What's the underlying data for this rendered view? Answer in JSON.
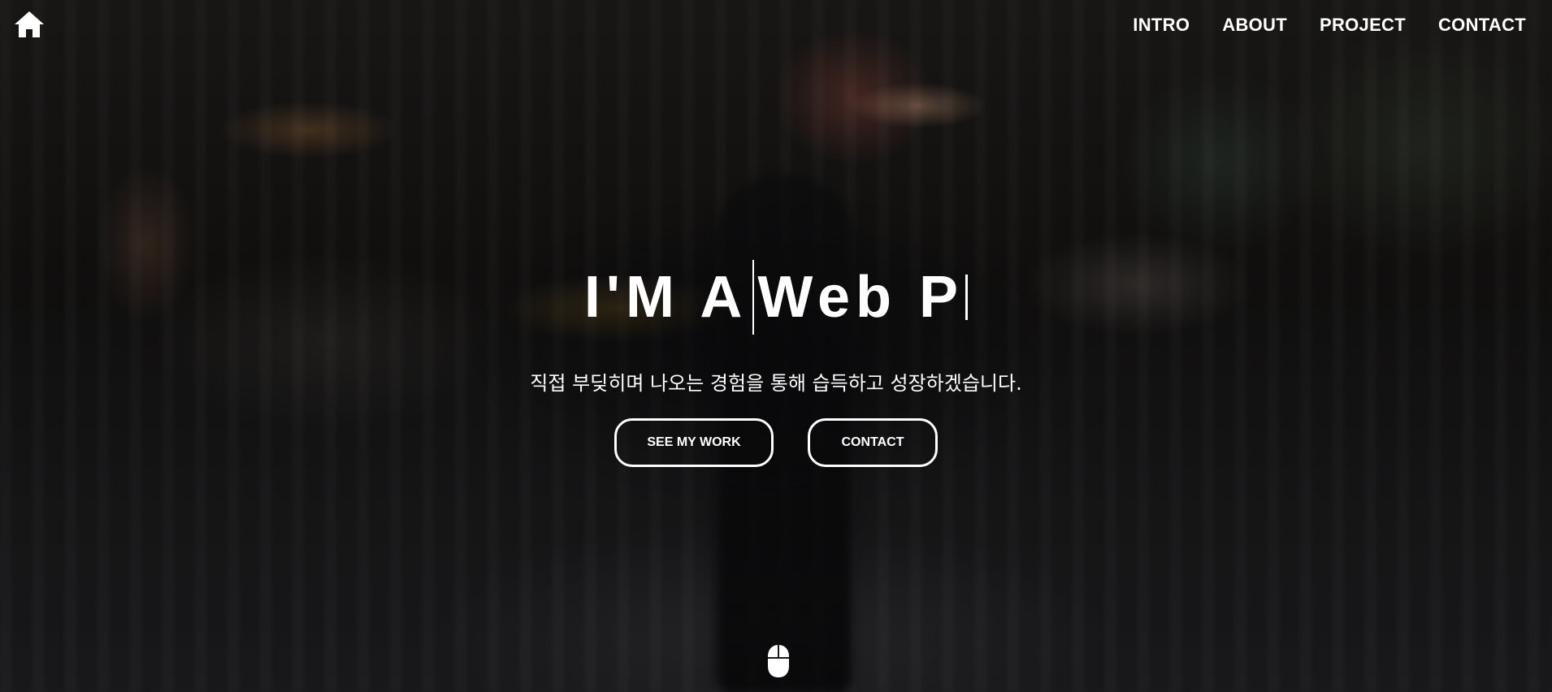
{
  "nav": {
    "home_icon": "home-icon",
    "items": [
      {
        "label": "INTRO"
      },
      {
        "label": "ABOUT"
      },
      {
        "label": "PROJECT"
      },
      {
        "label": "CONTACT"
      }
    ]
  },
  "hero": {
    "headline_prefix": "I'M A",
    "headline_typed": "Web P",
    "subtitle": "직접 부딪히며 나오는 경험을 통해 습득하고 성장하겠습니다.",
    "buttons": {
      "see_my_work": "SEE MY WORK",
      "contact": "CONTACT"
    },
    "scroll_icon": "mouse-icon"
  },
  "colors": {
    "text": "#ffffff",
    "button_border": "#ffffff"
  }
}
